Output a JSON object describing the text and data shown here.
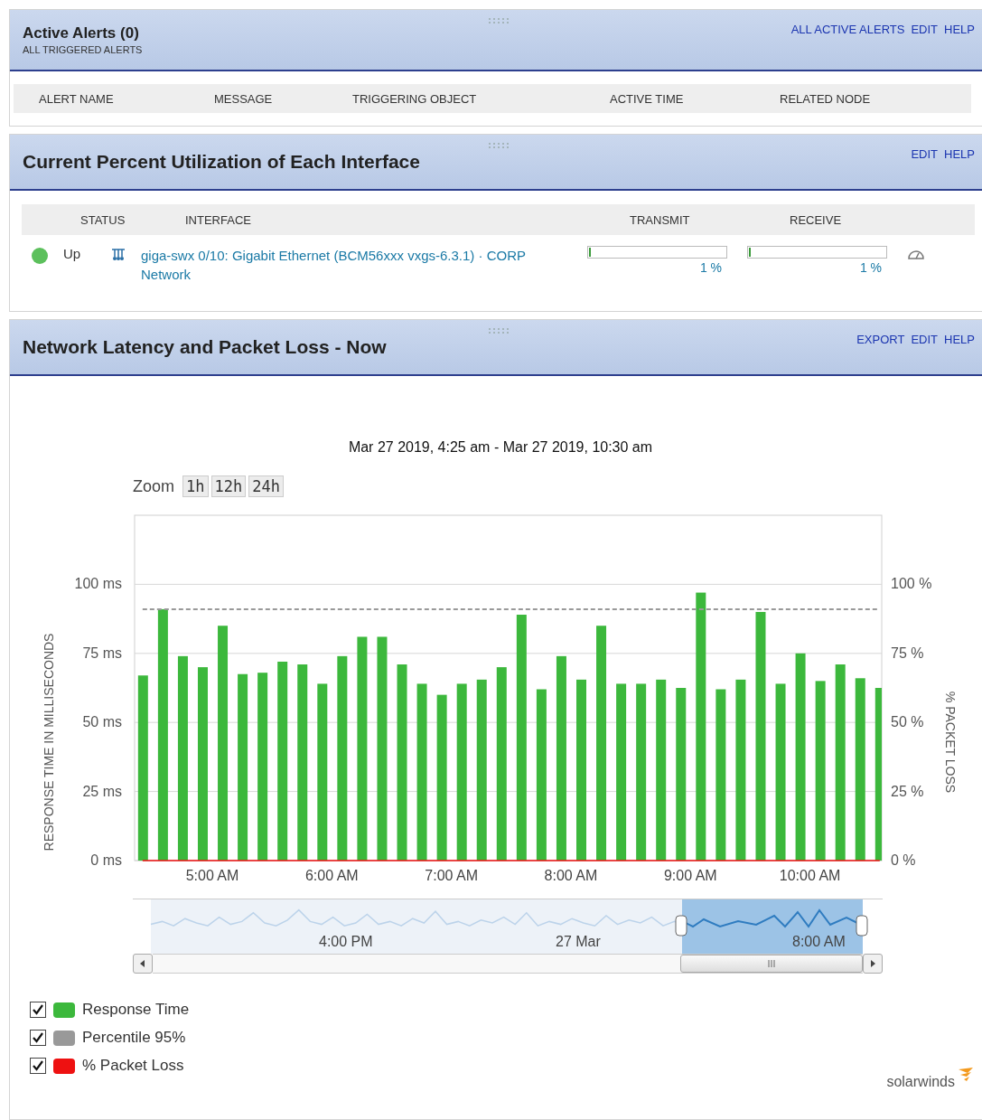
{
  "alerts_panel": {
    "title": "Active Alerts (0)",
    "subtitle": "ALL TRIGGERED ALERTS",
    "links": [
      "ALL ACTIVE ALERTS",
      "EDIT",
      "HELP"
    ],
    "columns": [
      "ALERT NAME",
      "MESSAGE",
      "TRIGGERING OBJECT",
      "ACTIVE TIME",
      "RELATED NODE"
    ]
  },
  "utilization_panel": {
    "title": "Current Percent Utilization of Each Interface",
    "links": [
      "EDIT",
      "HELP"
    ],
    "columns": [
      "STATUS",
      "INTERFACE",
      "TRANSMIT",
      "RECEIVE"
    ],
    "rows": [
      {
        "online": true,
        "status": "Up",
        "interface": "giga-swx 0/10: Gigabit Ethernet (BCM56xxx vxgs-6.3.1) · CORP Network",
        "transmit": {
          "level": 0.01,
          "reading": "1 %"
        },
        "receive": {
          "level": 0.01,
          "reading": "1 %"
        }
      }
    ]
  },
  "latency_panel": {
    "title": "Network Latency and Packet Loss - Now",
    "links": [
      "EXPORT",
      "EDIT",
      "HELP"
    ],
    "date_range": "Mar 27 2019, 4:25 am - Mar 27 2019, 10:30 am",
    "zoom_label": "Zoom",
    "zoom_buttons": [
      "1h",
      "12h",
      "24h"
    ],
    "chart_data": {
      "type": "bar",
      "ylabel": "RESPONSE TIME IN MILLISECONDS",
      "y2label": "% PACKET LOSS",
      "x": [
        265,
        275,
        285,
        295,
        305,
        315,
        325,
        335,
        345,
        355,
        365,
        375,
        385,
        395,
        405,
        415,
        425,
        435,
        445,
        455,
        465,
        475,
        485,
        495,
        505,
        515,
        525,
        535,
        545,
        555,
        565,
        575,
        585,
        595,
        605,
        615,
        625,
        635
      ],
      "xlim": [
        261,
        636
      ],
      "ylim": [
        0,
        125
      ],
      "y2lim": [
        0,
        125
      ],
      "grid": true,
      "xticks": [
        {
          "value": 300,
          "label": "5:00 AM"
        },
        {
          "value": 360,
          "label": "6:00 AM"
        },
        {
          "value": 420,
          "label": "7:00 AM"
        },
        {
          "value": 480,
          "label": "8:00 AM"
        },
        {
          "value": 540,
          "label": "9:00 AM"
        },
        {
          "value": 600,
          "label": "10:00 AM"
        }
      ],
      "yticks": [
        {
          "value": 0,
          "label": "0 ms"
        },
        {
          "value": 25,
          "label": "25 ms"
        },
        {
          "value": 50,
          "label": "50 ms"
        },
        {
          "value": 75,
          "label": "75 ms"
        },
        {
          "value": 100,
          "label": "100 ms"
        }
      ],
      "y2ticks": [
        {
          "value": 0,
          "label": "0 %"
        },
        {
          "value": 25,
          "label": "25 %"
        },
        {
          "value": 50,
          "label": "50 %"
        },
        {
          "value": 75,
          "label": "75 %"
        },
        {
          "value": 100,
          "label": "100 %"
        }
      ],
      "series": [
        {
          "name": "Response Time",
          "color": "#3cb83c",
          "values": [
            67,
            91,
            74,
            70,
            85,
            67.5,
            68,
            72,
            71,
            64,
            74,
            81,
            81,
            71,
            64,
            60,
            64,
            65.5,
            70,
            89,
            62,
            74,
            65.5,
            85,
            64,
            64,
            65.5,
            62.5,
            97,
            62,
            65.5,
            90,
            64,
            75,
            65,
            71,
            66,
            62.5
          ]
        },
        {
          "name": "Percentile 95%",
          "type": "line",
          "line_style": "dashed",
          "color": "#999999",
          "values": [
            91,
            91,
            91,
            91,
            91,
            91,
            91,
            91,
            91,
            91,
            91,
            91,
            91,
            91,
            91,
            91,
            91,
            91,
            91,
            91,
            91,
            91,
            91,
            91,
            91,
            91,
            91,
            91,
            91,
            91,
            91,
            91,
            91,
            91,
            91,
            91,
            91,
            91
          ]
        },
        {
          "name": "% Packet Loss",
          "type": "line",
          "color": "#ee1111",
          "values": [
            0,
            0,
            0,
            0,
            0,
            0,
            0,
            0,
            0,
            0,
            0,
            0,
            0,
            0,
            0,
            0,
            0,
            0,
            0,
            0,
            0,
            0,
            0,
            0,
            0,
            0,
            0,
            0,
            0,
            0,
            0,
            0,
            0,
            0,
            0,
            0,
            0,
            0
          ]
        }
      ]
    },
    "navigator": {
      "labels": [
        "4:00 PM",
        "27 Mar",
        "8:00 AM"
      ]
    },
    "legend": [
      {
        "checked": true
      },
      {
        "checked": true
      },
      {
        "checked": true
      }
    ],
    "logo": "solarwinds"
  }
}
